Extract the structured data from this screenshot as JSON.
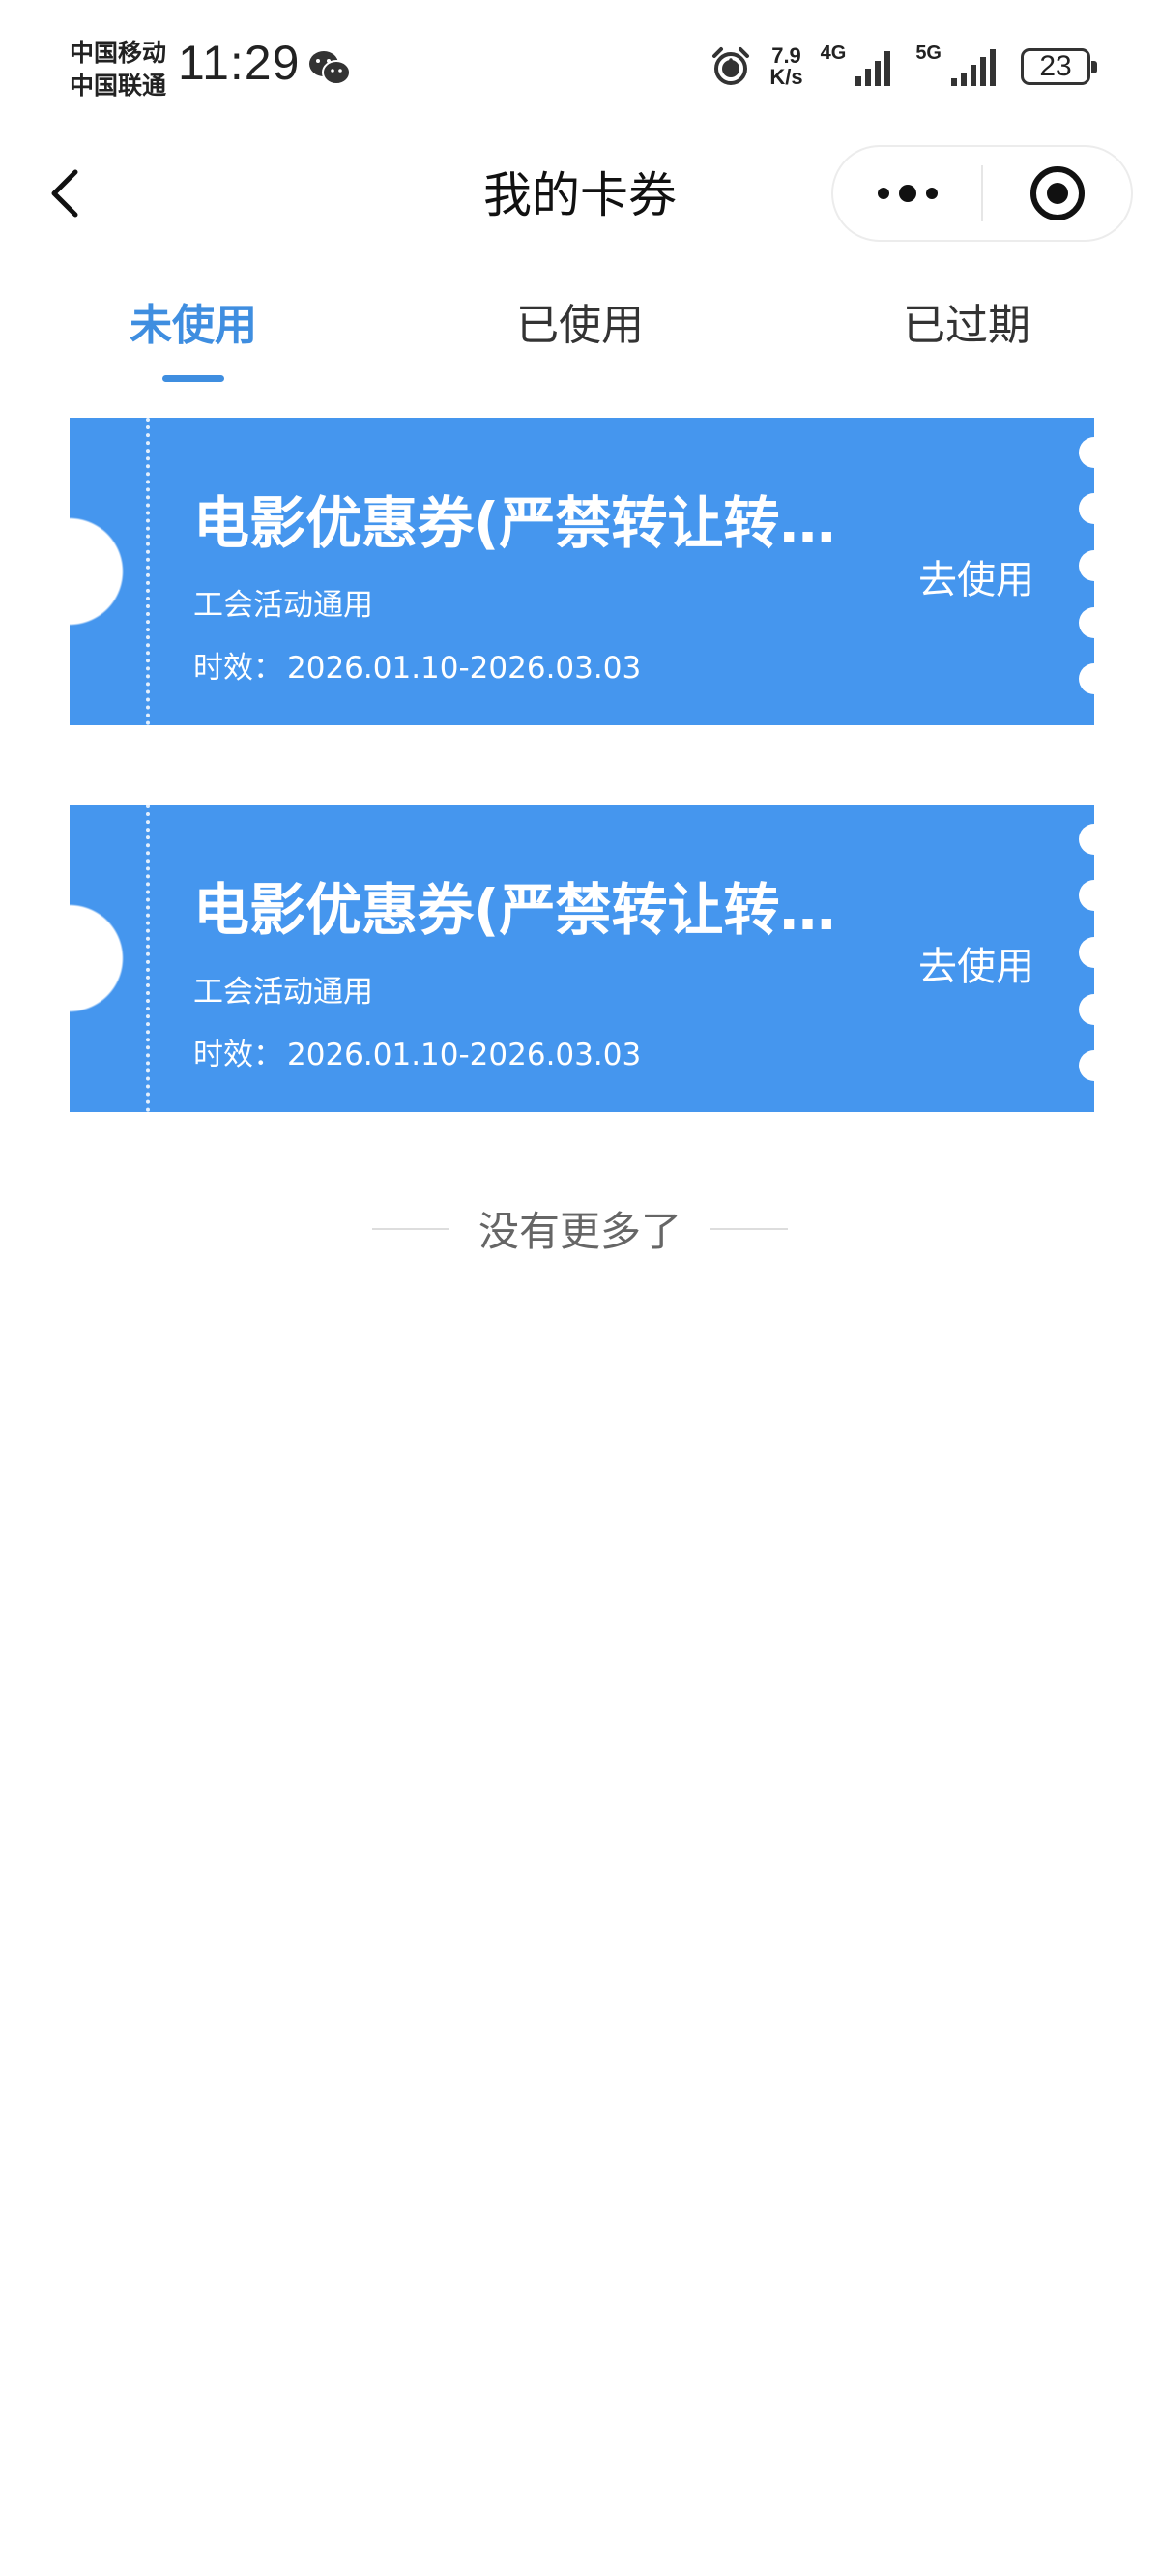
{
  "status_bar": {
    "carrier_1": "中国移动",
    "carrier_2": "中国联通",
    "time": "11:29",
    "net_speed_value": "7.9",
    "net_speed_unit": "K/s",
    "signal_1_label": "4G",
    "signal_2_label": "5G",
    "battery": "23"
  },
  "nav": {
    "title": "我的卡券"
  },
  "tabs": [
    {
      "label": "未使用",
      "active": true
    },
    {
      "label": "已使用",
      "active": false
    },
    {
      "label": "已过期",
      "active": false
    }
  ],
  "coupons": [
    {
      "title": "电影优惠券(严禁转让转售)",
      "subtitle": "工会活动通用",
      "validity_label": "时效：",
      "validity": "2026.01.10-2026.03.03",
      "action": "去使用"
    },
    {
      "title": "电影优惠券(严禁转让转售)",
      "subtitle": "工会活动通用",
      "validity_label": "时效：",
      "validity": "2026.01.10-2026.03.03",
      "action": "去使用"
    }
  ],
  "footer": {
    "no_more": "没有更多了"
  },
  "colors": {
    "accent": "#3f8ee0",
    "coupon_bg": "#4596ee"
  },
  "icons": {
    "back": "chevron-left-icon",
    "more": "more-dots-icon",
    "close": "target-circle-icon",
    "alarm": "alarm-clock-icon",
    "wechat": "wechat-icon"
  }
}
